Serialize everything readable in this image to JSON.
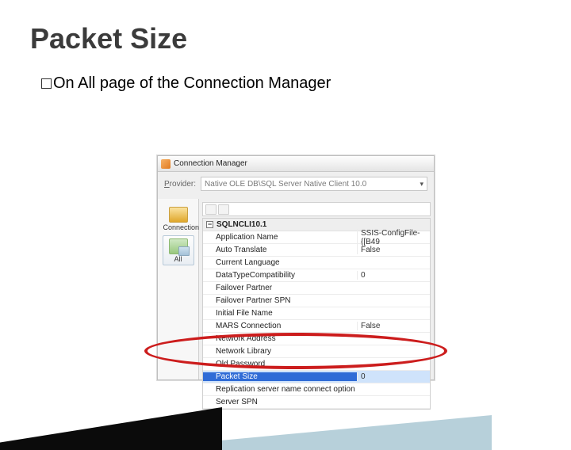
{
  "slide": {
    "title": "Packet Size",
    "bullet": "On All page of the Connection Manager"
  },
  "win": {
    "title": "Connection Manager",
    "provider_label_left": "P",
    "provider_label_rest": "rovider:",
    "provider_value": "Native OLE DB\\SQL Server Native Client 10.0"
  },
  "nav": {
    "connection": "Connection",
    "all": "All"
  },
  "toolbar": {
    "az": "A↓",
    "sort": "Z↓"
  },
  "grid": {
    "category": "SQLNCLI10.1",
    "rows": [
      {
        "k": "Application Name",
        "v": "SSIS-ConfigFile-{[B49"
      },
      {
        "k": "Auto Translate",
        "v": "False"
      },
      {
        "k": "Current Language",
        "v": ""
      },
      {
        "k": "DataTypeCompatibility",
        "v": "0"
      },
      {
        "k": "Failover Partner",
        "v": ""
      },
      {
        "k": "Failover Partner SPN",
        "v": ""
      },
      {
        "k": "Initial File Name",
        "v": ""
      },
      {
        "k": "MARS Connection",
        "v": "False"
      },
      {
        "k": "Network Address",
        "v": ""
      },
      {
        "k": "Network Library",
        "v": ""
      },
      {
        "k": "Old Password",
        "v": ""
      },
      {
        "k": "Packet Size",
        "v": "0"
      },
      {
        "k": "Replication server name connect option",
        "v": ""
      },
      {
        "k": "Server SPN",
        "v": ""
      }
    ],
    "selected_index": 11
  }
}
